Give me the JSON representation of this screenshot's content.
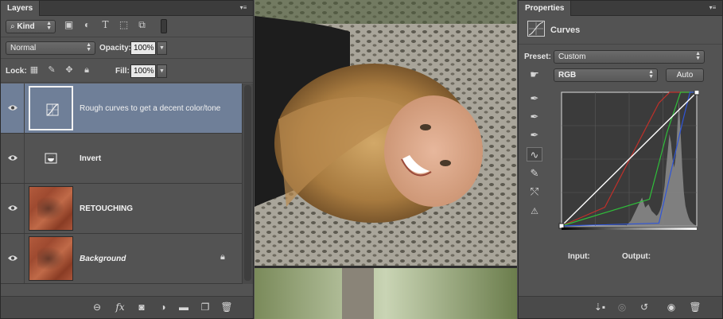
{
  "layers_panel": {
    "tab_label": "Layers",
    "filter": {
      "kind_label": "Kind",
      "icons": [
        "image-filter-icon",
        "adjustment-filter-icon",
        "type-filter-icon",
        "shape-filter-icon",
        "smart-object-filter-icon",
        "filter-toggle-icon"
      ]
    },
    "blend_mode": "Normal",
    "opacity_label": "Opacity:",
    "opacity_value": "100%",
    "lock_label": "Lock:",
    "fill_label": "Fill:",
    "fill_value": "100%",
    "layers": [
      {
        "name": "Rough curves to get a decent color/tone",
        "type": "adjustment-curves",
        "selected": true,
        "visible": true,
        "locked": false
      },
      {
        "name": "Invert",
        "type": "adjustment-invert",
        "selected": false,
        "visible": true,
        "locked": false
      },
      {
        "name": "RETOUCHING",
        "type": "pixel",
        "selected": false,
        "visible": true,
        "locked": false
      },
      {
        "name": "Background",
        "type": "pixel",
        "selected": false,
        "visible": true,
        "locked": true
      }
    ],
    "bottom_icons": [
      "link-layers-icon",
      "fx-icon",
      "add-mask-icon",
      "new-adjustment-icon",
      "new-group-icon",
      "new-layer-icon",
      "delete-layer-icon"
    ]
  },
  "properties_panel": {
    "tab_label": "Properties",
    "adjustment_title": "Curves",
    "preset_label": "Preset:",
    "preset_value": "Custom",
    "channel_value": "RGB",
    "auto_label": "Auto",
    "input_label": "Input:",
    "output_label": "Output:",
    "tools": [
      "on-image-adjust-icon",
      "black-point-eyedropper-icon",
      "gray-point-eyedropper-icon",
      "white-point-eyedropper-icon",
      "curve-points-icon",
      "pencil-icon",
      "smooth-icon",
      "clipping-warning-icon"
    ],
    "curves": {
      "colors": {
        "rgb": "#ffffff",
        "red": "#c0302a",
        "green": "#2fbf3a",
        "blue": "#2f55d8"
      },
      "red": [
        [
          0,
          0
        ],
        [
          0.32,
          0.14
        ],
        [
          0.72,
          0.92
        ],
        [
          0.8,
          1
        ]
      ],
      "green": [
        [
          0,
          0
        ],
        [
          0.65,
          0.2
        ],
        [
          0.78,
          0.7
        ],
        [
          0.88,
          1
        ]
      ],
      "blue": [
        [
          0,
          0
        ],
        [
          0.72,
          0.02
        ],
        [
          0.9,
          0.8
        ],
        [
          0.95,
          1
        ]
      ],
      "rgb": [
        [
          0,
          0
        ],
        [
          1,
          1
        ]
      ]
    },
    "bottom_icons": [
      "clip-to-layer-icon",
      "view-previous-icon",
      "reset-icon",
      "visibility-icon",
      "delete-adjustment-icon"
    ]
  },
  "colors": {
    "panel_bg": "#535353",
    "selected_layer": "#6f7f98",
    "accent": "#6f7f98"
  }
}
